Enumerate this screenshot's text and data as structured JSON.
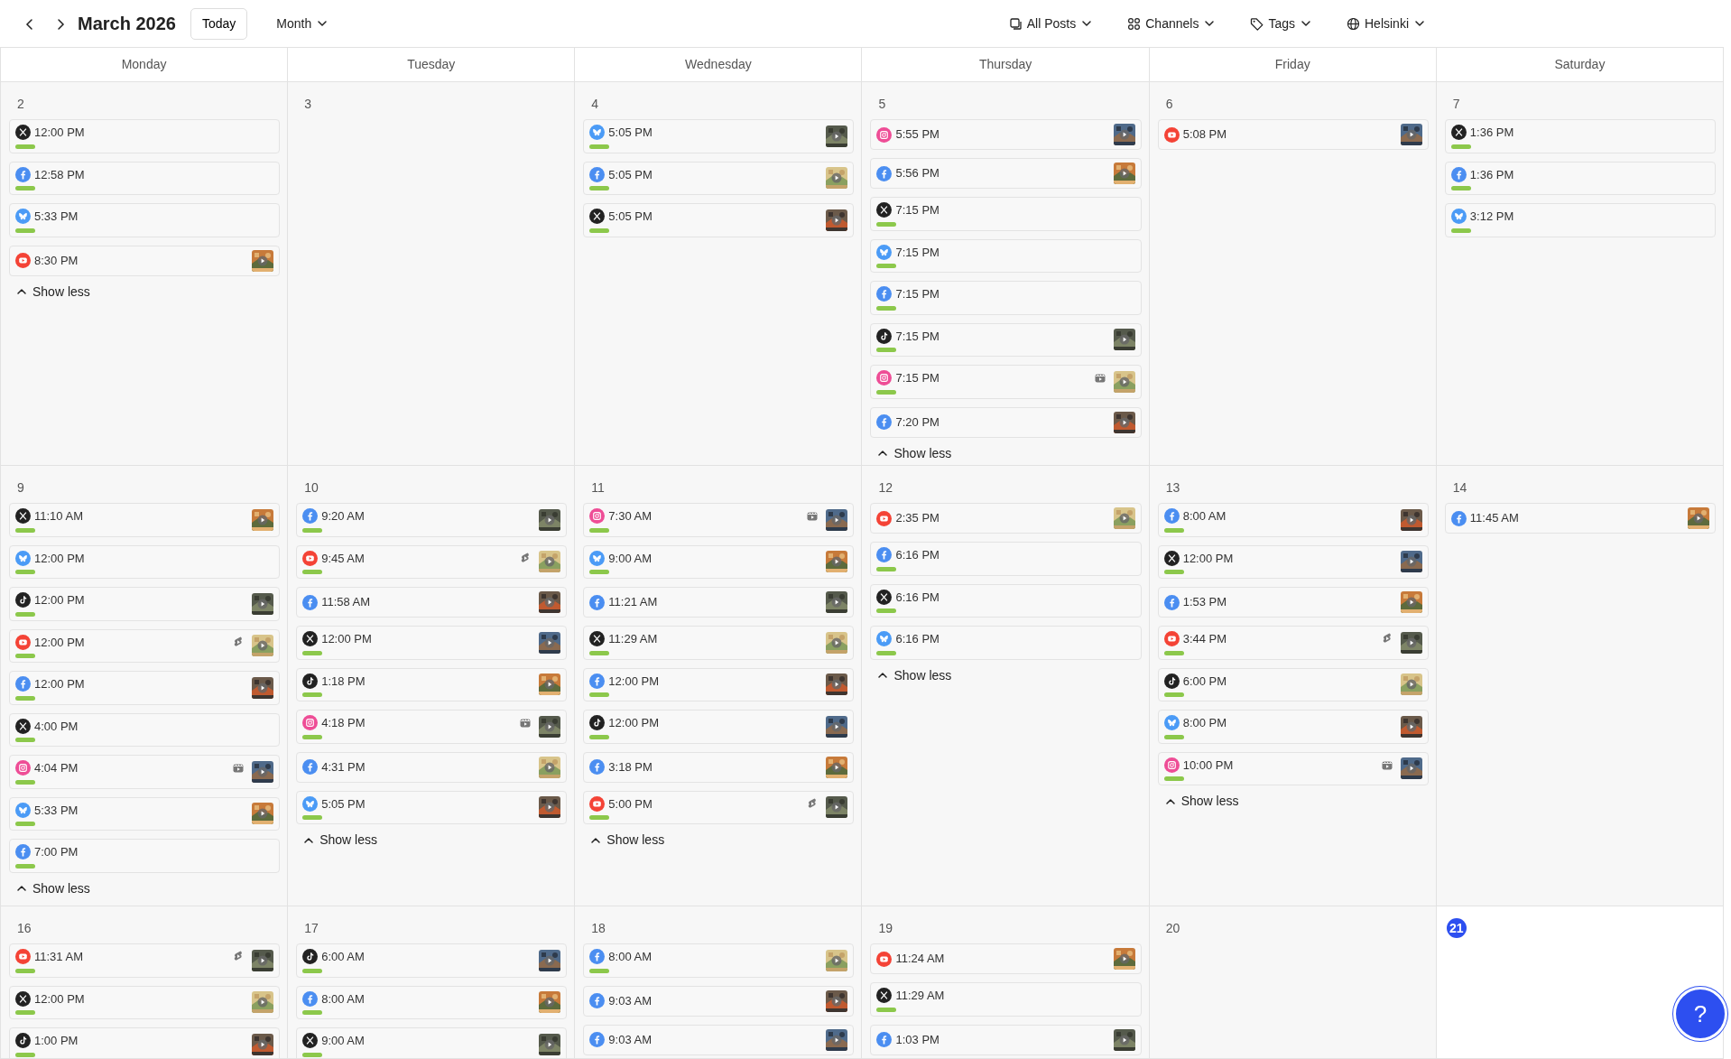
{
  "toolbar": {
    "title": "March 2026",
    "today_button": "Today",
    "view": "Month",
    "filters": [
      {
        "kind": "posts",
        "label": "All Posts"
      },
      {
        "kind": "channels",
        "label": "Channels"
      },
      {
        "kind": "tags",
        "label": "Tags"
      },
      {
        "kind": "timezone",
        "label": "Helsinki"
      }
    ]
  },
  "weekdays": [
    "Monday",
    "Tuesday",
    "Wednesday",
    "Thursday",
    "Friday",
    "Saturday"
  ],
  "weeks": [
    {
      "days": [
        {
          "date": "2",
          "today": false,
          "toggle": "Show less",
          "posts": [
            {
              "kind": "x",
              "time": "12:00 PM",
              "published": true,
              "thumbnail": false
            },
            {
              "kind": "facebook",
              "time": "12:58 PM",
              "published": true,
              "thumbnail": false
            },
            {
              "kind": "bluesky",
              "time": "5:33 PM",
              "published": true,
              "thumbnail": false
            },
            {
              "kind": "youtube",
              "time": "8:30 PM",
              "published": false,
              "thumbnail": true
            }
          ]
        },
        {
          "date": "3",
          "today": false
        },
        {
          "date": "4",
          "today": false,
          "posts": [
            {
              "kind": "bluesky",
              "time": "5:05 PM",
              "published": true,
              "thumbnail": true
            },
            {
              "kind": "facebook",
              "time": "5:05 PM",
              "published": true,
              "thumbnail": true
            },
            {
              "kind": "x",
              "time": "5:05 PM",
              "published": true,
              "thumbnail": true
            }
          ]
        },
        {
          "date": "5",
          "today": false,
          "toggle": "Show less",
          "posts": [
            {
              "kind": "instagram",
              "time": "5:55 PM",
              "published": false,
              "thumbnail": true
            },
            {
              "kind": "facebook",
              "time": "5:56 PM",
              "published": false,
              "thumbnail": true
            },
            {
              "kind": "x",
              "time": "7:15 PM",
              "published": true,
              "thumbnail": false
            },
            {
              "kind": "bluesky",
              "time": "7:15 PM",
              "published": true,
              "thumbnail": false
            },
            {
              "kind": "facebook",
              "time": "7:15 PM",
              "published": true,
              "thumbnail": false
            },
            {
              "kind": "tiktok",
              "time": "7:15 PM",
              "published": true,
              "thumbnail": true
            },
            {
              "kind": "instagram",
              "time": "7:15 PM",
              "published": true,
              "thumbnail": true,
              "badge": {
                "kind": "reel"
              }
            },
            {
              "kind": "facebook",
              "time": "7:20 PM",
              "published": false,
              "thumbnail": true
            }
          ]
        },
        {
          "date": "6",
          "today": false,
          "posts": [
            {
              "kind": "youtube",
              "time": "5:08 PM",
              "published": false,
              "thumbnail": true
            }
          ]
        },
        {
          "date": "7",
          "today": false,
          "posts": [
            {
              "kind": "x",
              "time": "1:36 PM",
              "published": true,
              "thumbnail": false
            },
            {
              "kind": "facebook",
              "time": "1:36 PM",
              "published": true,
              "thumbnail": false
            },
            {
              "kind": "bluesky",
              "time": "3:12 PM",
              "published": true,
              "thumbnail": false
            }
          ]
        }
      ]
    },
    {
      "days": [
        {
          "date": "9",
          "today": false,
          "toggle": "Show less",
          "posts": [
            {
              "kind": "x",
              "time": "11:10 AM",
              "published": true,
              "thumbnail": true
            },
            {
              "kind": "bluesky",
              "time": "12:00 PM",
              "published": true,
              "thumbnail": false
            },
            {
              "kind": "tiktok",
              "time": "12:00 PM",
              "published": true,
              "thumbnail": true
            },
            {
              "kind": "youtube",
              "time": "12:00 PM",
              "published": true,
              "thumbnail": true,
              "badge": {
                "kind": "short"
              }
            },
            {
              "kind": "facebook",
              "time": "12:00 PM",
              "published": true,
              "thumbnail": true
            },
            {
              "kind": "x",
              "time": "4:00 PM",
              "published": true,
              "thumbnail": false
            },
            {
              "kind": "instagram",
              "time": "4:04 PM",
              "published": true,
              "thumbnail": true,
              "badge": {
                "kind": "reel"
              }
            },
            {
              "kind": "bluesky",
              "time": "5:33 PM",
              "published": true,
              "thumbnail": true
            },
            {
              "kind": "facebook",
              "time": "7:00 PM",
              "published": true,
              "thumbnail": false
            }
          ]
        },
        {
          "date": "10",
          "today": false,
          "toggle": "Show less",
          "posts": [
            {
              "kind": "facebook",
              "time": "9:20 AM",
              "published": true,
              "thumbnail": true
            },
            {
              "kind": "youtube",
              "time": "9:45 AM",
              "published": true,
              "thumbnail": true,
              "badge": {
                "kind": "short"
              }
            },
            {
              "kind": "facebook",
              "time": "11:58 AM",
              "published": false,
              "thumbnail": true
            },
            {
              "kind": "x",
              "time": "12:00 PM",
              "published": true,
              "thumbnail": true
            },
            {
              "kind": "tiktok",
              "time": "1:18 PM",
              "published": true,
              "thumbnail": true
            },
            {
              "kind": "instagram",
              "time": "4:18 PM",
              "published": true,
              "thumbnail": true,
              "badge": {
                "kind": "reel"
              }
            },
            {
              "kind": "facebook",
              "time": "4:31 PM",
              "published": false,
              "thumbnail": true
            },
            {
              "kind": "bluesky",
              "time": "5:05 PM",
              "published": true,
              "thumbnail": true
            }
          ]
        },
        {
          "date": "11",
          "today": false,
          "toggle": "Show less",
          "posts": [
            {
              "kind": "instagram",
              "time": "7:30 AM",
              "published": true,
              "thumbnail": true,
              "badge": {
                "kind": "reel"
              }
            },
            {
              "kind": "bluesky",
              "time": "9:00 AM",
              "published": true,
              "thumbnail": true
            },
            {
              "kind": "facebook",
              "time": "11:21 AM",
              "published": false,
              "thumbnail": true
            },
            {
              "kind": "x",
              "time": "11:29 AM",
              "published": true,
              "thumbnail": true
            },
            {
              "kind": "facebook",
              "time": "12:00 PM",
              "published": true,
              "thumbnail": true
            },
            {
              "kind": "tiktok",
              "time": "12:00 PM",
              "published": true,
              "thumbnail": true
            },
            {
              "kind": "facebook",
              "time": "3:18 PM",
              "published": false,
              "thumbnail": true
            },
            {
              "kind": "youtube",
              "time": "5:00 PM",
              "published": true,
              "thumbnail": true,
              "badge": {
                "kind": "short"
              }
            }
          ]
        },
        {
          "date": "12",
          "today": false,
          "toggle": "Show less",
          "posts": [
            {
              "kind": "youtube",
              "time": "2:35 PM",
              "published": false,
              "thumbnail": true
            },
            {
              "kind": "facebook",
              "time": "6:16 PM",
              "published": true,
              "thumbnail": false
            },
            {
              "kind": "x",
              "time": "6:16 PM",
              "published": true,
              "thumbnail": false
            },
            {
              "kind": "bluesky",
              "time": "6:16 PM",
              "published": true,
              "thumbnail": false
            }
          ]
        },
        {
          "date": "13",
          "today": false,
          "toggle": "Show less",
          "posts": [
            {
              "kind": "facebook",
              "time": "8:00 AM",
              "published": true,
              "thumbnail": true
            },
            {
              "kind": "x",
              "time": "12:00 PM",
              "published": true,
              "thumbnail": true
            },
            {
              "kind": "facebook",
              "time": "1:53 PM",
              "published": false,
              "thumbnail": true
            },
            {
              "kind": "youtube",
              "time": "3:44 PM",
              "published": true,
              "thumbnail": true,
              "badge": {
                "kind": "short"
              }
            },
            {
              "kind": "tiktok",
              "time": "6:00 PM",
              "published": true,
              "thumbnail": true
            },
            {
              "kind": "bluesky",
              "time": "8:00 PM",
              "published": true,
              "thumbnail": true
            },
            {
              "kind": "instagram",
              "time": "10:00 PM",
              "published": true,
              "thumbnail": true,
              "badge": {
                "kind": "reel"
              }
            }
          ]
        },
        {
          "date": "14",
          "today": false,
          "posts": [
            {
              "kind": "facebook",
              "time": "11:45 AM",
              "published": false,
              "thumbnail": true
            }
          ]
        }
      ]
    },
    {
      "days": [
        {
          "date": "16",
          "today": false,
          "posts": [
            {
              "kind": "youtube",
              "time": "11:31 AM",
              "published": true,
              "thumbnail": true,
              "badge": {
                "kind": "short"
              }
            },
            {
              "kind": "x",
              "time": "12:00 PM",
              "published": true,
              "thumbnail": true
            },
            {
              "kind": "tiktok",
              "time": "1:00 PM",
              "published": true,
              "thumbnail": true
            }
          ]
        },
        {
          "date": "17",
          "today": false,
          "posts": [
            {
              "kind": "tiktok",
              "time": "6:00 AM",
              "published": true,
              "thumbnail": true
            },
            {
              "kind": "facebook",
              "time": "8:00 AM",
              "published": true,
              "thumbnail": true
            },
            {
              "kind": "x",
              "time": "9:00 AM",
              "published": true,
              "thumbnail": true
            }
          ]
        },
        {
          "date": "18",
          "today": false,
          "posts": [
            {
              "kind": "facebook",
              "time": "8:00 AM",
              "published": true,
              "thumbnail": true
            },
            {
              "kind": "facebook",
              "time": "9:03 AM",
              "published": false,
              "thumbnail": true
            },
            {
              "kind": "facebook",
              "time": "9:03 AM",
              "published": false,
              "thumbnail": true
            }
          ]
        },
        {
          "date": "19",
          "today": false,
          "posts": [
            {
              "kind": "youtube",
              "time": "11:24 AM",
              "published": false,
              "thumbnail": true
            },
            {
              "kind": "x",
              "time": "11:29 AM",
              "published": true,
              "thumbnail": false
            },
            {
              "kind": "facebook",
              "time": "1:03 PM",
              "published": false,
              "thumbnail": true
            }
          ]
        },
        {
          "date": "20",
          "today": false
        },
        {
          "date": "21",
          "today": true
        }
      ]
    }
  ],
  "help_button": {
    "label": "?"
  }
}
